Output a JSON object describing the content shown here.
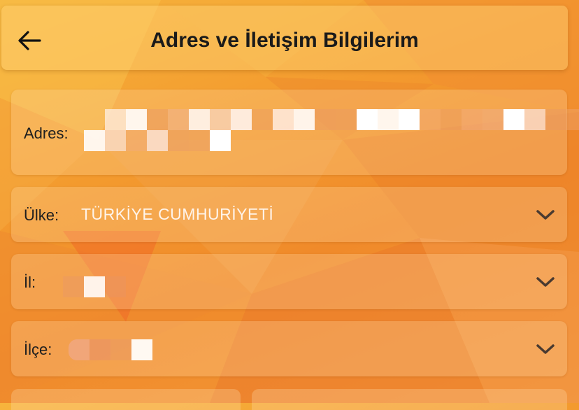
{
  "header": {
    "title": "Adres ve İletişim Bilgilerim",
    "back_icon": "arrow-left-icon"
  },
  "form": {
    "address": {
      "label": "Adres:",
      "value": ""
    },
    "country": {
      "label": "Ülke:",
      "value": "TÜRKİYE CUMHURİYETİ"
    },
    "city": {
      "label": "İl:",
      "value": ""
    },
    "district": {
      "label": "İlçe:",
      "value": ""
    }
  },
  "colors": {
    "background_primary": "#f39a2e",
    "background_light": "#f7b43c",
    "text_dark": "#1a1a1a",
    "value_light": "#fff4ea"
  }
}
